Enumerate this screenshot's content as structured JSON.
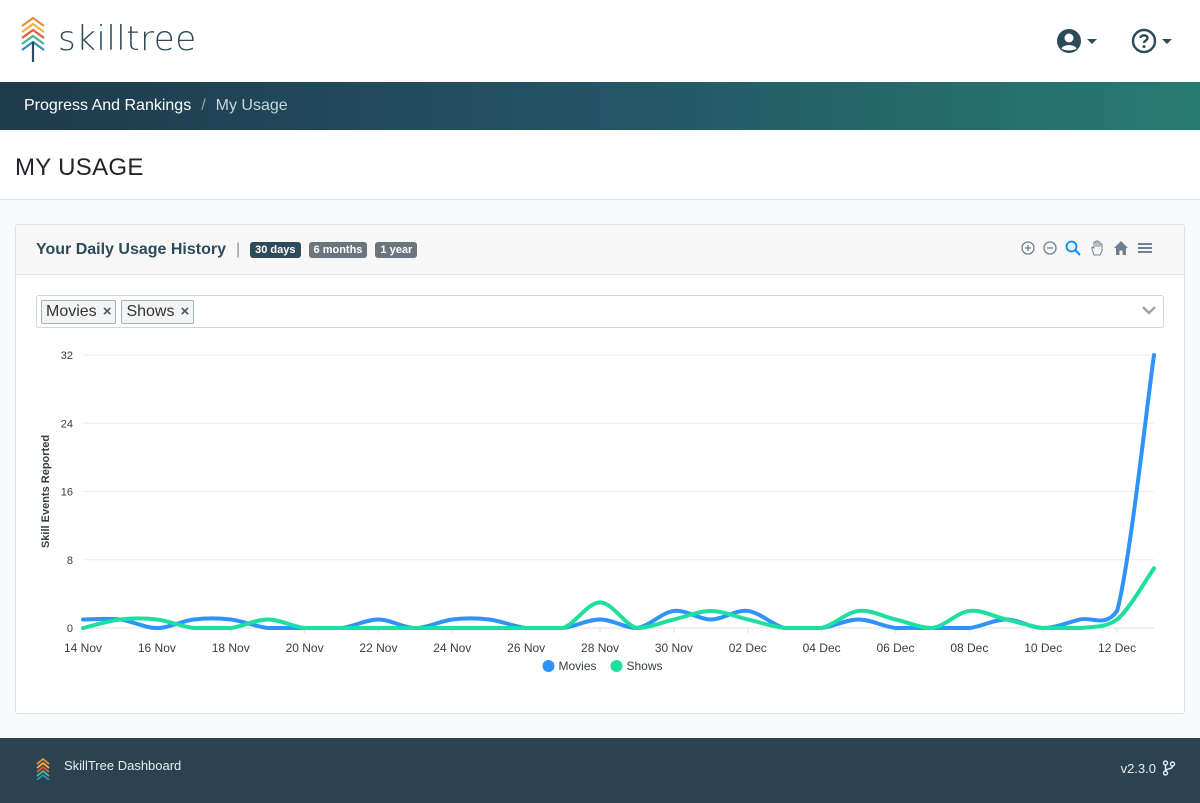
{
  "app": {
    "logo_text": "skilltree"
  },
  "header": {
    "user_icon": "user-circle-icon",
    "help_icon": "question-circle-icon"
  },
  "breadcrumb": {
    "items": [
      "Progress And Rankings",
      "My Usage"
    ]
  },
  "page": {
    "title": "MY USAGE"
  },
  "card": {
    "title": "Your Daily Usage History",
    "separator": "|",
    "ranges": [
      "30 days",
      "6 months",
      "1 year"
    ],
    "tools": [
      "zoom-in-icon",
      "zoom-out-icon",
      "selection-zoom-icon",
      "pan-icon",
      "reset-home-icon",
      "menu-icon"
    ]
  },
  "filter": {
    "selected": [
      "Movies",
      "Shows"
    ]
  },
  "footer": {
    "brand": "SkillTree Dashboard",
    "version": "v2.3.0"
  },
  "colors": {
    "movies": "#2e93fa",
    "shows": "#1edfa0",
    "accent": "#2d4b5a"
  },
  "chart_data": {
    "type": "line",
    "title": "",
    "xlabel": "",
    "ylabel": "Skill Events Reported",
    "ylim": [
      0,
      32
    ],
    "yticks": [
      0,
      8,
      16,
      24,
      32
    ],
    "x_labels": [
      "14 Nov",
      "16 Nov",
      "18 Nov",
      "20 Nov",
      "22 Nov",
      "24 Nov",
      "26 Nov",
      "28 Nov",
      "30 Nov",
      "02 Dec",
      "04 Dec",
      "06 Dec",
      "08 Dec",
      "10 Dec",
      "12 Dec"
    ],
    "x": [
      "14 Nov",
      "15 Nov",
      "16 Nov",
      "17 Nov",
      "18 Nov",
      "19 Nov",
      "20 Nov",
      "21 Nov",
      "22 Nov",
      "23 Nov",
      "24 Nov",
      "25 Nov",
      "26 Nov",
      "27 Nov",
      "28 Nov",
      "29 Nov",
      "30 Nov",
      "01 Dec",
      "02 Dec",
      "03 Dec",
      "04 Dec",
      "05 Dec",
      "06 Dec",
      "07 Dec",
      "08 Dec",
      "09 Dec",
      "10 Dec",
      "11 Dec",
      "12 Dec",
      "13 Dec"
    ],
    "legend": "bottom-center",
    "grid": true,
    "series": [
      {
        "name": "Movies",
        "values": [
          1,
          1,
          0,
          1,
          1,
          0,
          0,
          0,
          1,
          0,
          1,
          1,
          0,
          0,
          1,
          0,
          2,
          1,
          2,
          0,
          0,
          1,
          0,
          0,
          0,
          1,
          0,
          1,
          2,
          32
        ]
      },
      {
        "name": "Shows",
        "values": [
          0,
          1,
          1,
          0,
          0,
          1,
          0,
          0,
          0,
          0,
          0,
          0,
          0,
          0,
          3,
          0,
          1,
          2,
          1,
          0,
          0,
          2,
          1,
          0,
          2,
          1,
          0,
          0,
          1,
          7
        ]
      }
    ]
  }
}
